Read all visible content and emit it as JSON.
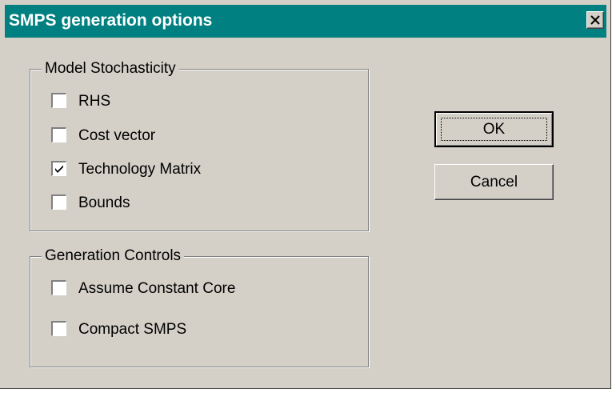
{
  "window": {
    "title": "SMPS generation options",
    "close_icon": "close-icon",
    "colors": {
      "titlebar": "#008080",
      "face": "#d4d0c8"
    }
  },
  "model_stochasticity": {
    "label": "Model Stochasticity",
    "items": [
      {
        "label": "RHS",
        "checked": false
      },
      {
        "label": "Cost vector",
        "checked": false
      },
      {
        "label": "Technology Matrix",
        "checked": true
      },
      {
        "label": "Bounds",
        "checked": false
      }
    ]
  },
  "generation_controls": {
    "label": "Generation Controls",
    "items": [
      {
        "label": "Assume Constant Core",
        "checked": false
      },
      {
        "label": "Compact SMPS",
        "checked": false
      }
    ]
  },
  "buttons": {
    "ok": "OK",
    "cancel": "Cancel"
  }
}
